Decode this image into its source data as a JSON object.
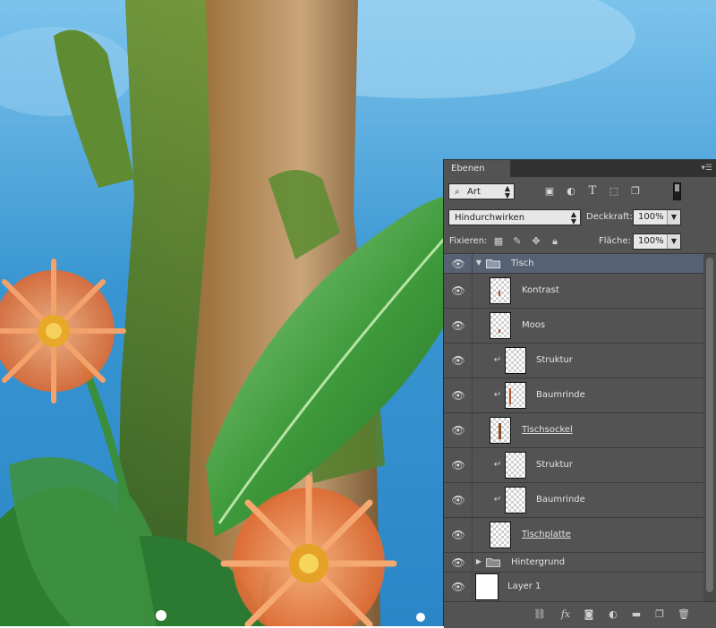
{
  "panel": {
    "tab_label": "Ebenen",
    "menu_icon": "panel-menu-icon",
    "filter": {
      "selected": "Art"
    },
    "blend_mode": {
      "selected": "Hindurchwirken"
    },
    "opacity_label": "Deckkraft:",
    "opacity_value": "100%",
    "lock_label": "Fixieren:",
    "fill_label": "Fläche:",
    "fill_value": "100%",
    "filter_icons": [
      "image-filter-icon",
      "adjustment-filter-icon",
      "type-filter-icon",
      "shape-filter-icon",
      "smart-object-filter-icon"
    ],
    "lock_icons": [
      "lock-transparency-icon",
      "lock-brush-icon",
      "lock-position-icon",
      "lock-all-icon"
    ],
    "bottom_icons": [
      "link-icon",
      "fx-icon",
      "mask-icon",
      "adjustment-icon",
      "new-group-icon",
      "new-layer-icon",
      "trash-icon"
    ]
  },
  "layers": [
    {
      "name": "Tisch",
      "type": "group",
      "expanded": true,
      "selected": true
    },
    {
      "name": "Kontrast",
      "type": "layer",
      "clipped": false,
      "underline": false
    },
    {
      "name": "Moos",
      "type": "layer",
      "clipped": false,
      "underline": false
    },
    {
      "name": "Struktur",
      "type": "layer",
      "clipped": true,
      "underline": false
    },
    {
      "name": "Baumrinde",
      "type": "layer",
      "clipped": true,
      "underline": false
    },
    {
      "name": "Tischsockel",
      "type": "layer",
      "clipped": false,
      "underline": true
    },
    {
      "name": "Struktur",
      "type": "layer",
      "clipped": true,
      "underline": false
    },
    {
      "name": "Baumrinde",
      "type": "layer",
      "clipped": true,
      "underline": false
    },
    {
      "name": "Tischplatte",
      "type": "layer",
      "clipped": false,
      "underline": true
    },
    {
      "name": "Hintergrund",
      "type": "group",
      "expanded": false,
      "selected": false
    },
    {
      "name": "Layer 1",
      "type": "layer",
      "clipped": false,
      "underline": false,
      "white_thumb": true
    }
  ],
  "colors": {
    "panel_bg": "#535353",
    "selection": "#576174",
    "sky": "#3b9ad3",
    "leaf": "#3f9a3b",
    "petal": "#e8854a"
  }
}
